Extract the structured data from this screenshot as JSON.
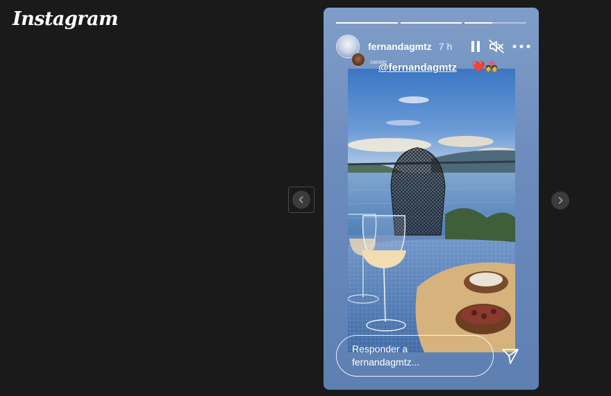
{
  "app": {
    "logo": "Instagram"
  },
  "story": {
    "username": "fernandagmtz",
    "time": "7 h",
    "progress": [
      1.0,
      1.0,
      0.45
    ],
    "mention": {
      "small_label": "canelo",
      "handle": "@fernandagmtz",
      "emoji": "❤️💑"
    },
    "reply": {
      "placeholder": "Responder a fernandagmtz..."
    }
  },
  "icons": {
    "pause": "pause-icon",
    "mute": "volume-muted-icon",
    "more": "more-options-icon",
    "send": "send-icon",
    "prev": "chevron-left-icon",
    "next": "chevron-right-icon"
  }
}
